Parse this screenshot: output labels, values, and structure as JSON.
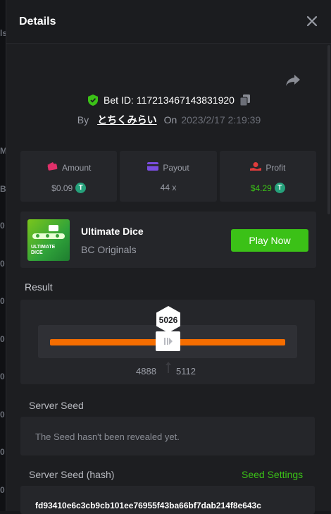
{
  "modal": {
    "title": "Details",
    "close_icon": "close-icon"
  },
  "bet": {
    "id_label": "Bet ID:",
    "id_value": "117213467143831920",
    "by_label": "By",
    "username": "とちくみらい",
    "on_label": "On",
    "timestamp": "2023/2/17 2:19:39"
  },
  "stats": {
    "amount": {
      "label": "Amount",
      "value": "$0.09",
      "icon": "wallet-icon",
      "color": "#e0306a"
    },
    "payout": {
      "label": "Payout",
      "value": "44 x",
      "icon": "card-icon",
      "color": "#7a4de0"
    },
    "profit": {
      "label": "Profit",
      "value": "$4.29",
      "icon": "hand-money-icon",
      "color": "#e03c3c",
      "value_color": "#3bc117"
    },
    "coin_symbol": "T"
  },
  "game": {
    "name": "Ultimate Dice",
    "provider": "BC Originals",
    "play_label": "Play Now",
    "thumb_text_1": "ULTIMATE",
    "thumb_text_2": "DICE"
  },
  "result": {
    "label": "Result",
    "value": "5026",
    "range_low": "4888",
    "range_high": "5112",
    "bar_color": "#f56d00"
  },
  "server_seed": {
    "label": "Server Seed",
    "message": "The Seed hasn't been revealed yet."
  },
  "server_seed_hash": {
    "label": "Server Seed (hash)",
    "settings_label": "Seed Settings",
    "value": "fd93410e6c3cb9cb101ee76955f43ba66bf7dab214f8e643c"
  },
  "background": {
    "side_chars": [
      "ls",
      "M",
      "B",
      "0",
      "0",
      "0",
      "0",
      "0",
      "0",
      "0",
      "0",
      "0",
      "0"
    ]
  },
  "colors": {
    "accent_green": "#3bc117",
    "panel": "#25262a",
    "modal_bg": "#1d1e21"
  }
}
